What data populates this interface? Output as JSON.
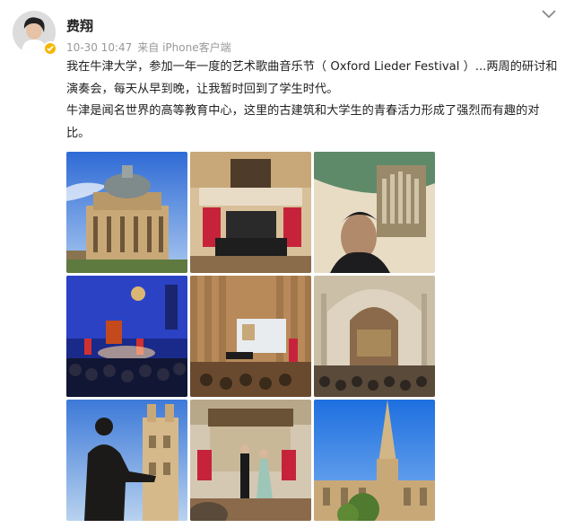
{
  "post": {
    "author": {
      "name": "费翔",
      "avatar_icon": "avatar-portrait",
      "verified_icon": "verified-badge-icon",
      "verified_color": "#f7b500"
    },
    "timestamp": "10-30 10:47",
    "source": "来自 iPhone客户端",
    "menu_icon": "chevron-down-icon",
    "text": {
      "paragraph1": "我在牛津大学，参加一年一度的艺术歌曲音乐节（ Oxford Lieder Festival ）...两周的研讨和演奏会，每天从早到晚，让我暂时回到了学生时代。",
      "paragraph2": "牛津是闻名世界的高等教育中心，这里的古建筑和大学生的青春活力形成了强烈而有趣的对比。"
    },
    "images": [
      {
        "name": "radcliffe-camera-photo"
      },
      {
        "name": "festival-stage-photo"
      },
      {
        "name": "organ-selfie-photo"
      },
      {
        "name": "blue-hall-concert-photo"
      },
      {
        "name": "recital-hall-photo"
      },
      {
        "name": "chapel-concert-photo"
      },
      {
        "name": "statue-silhouette-photo"
      },
      {
        "name": "duet-performance-photo"
      },
      {
        "name": "church-spire-photo"
      }
    ]
  }
}
